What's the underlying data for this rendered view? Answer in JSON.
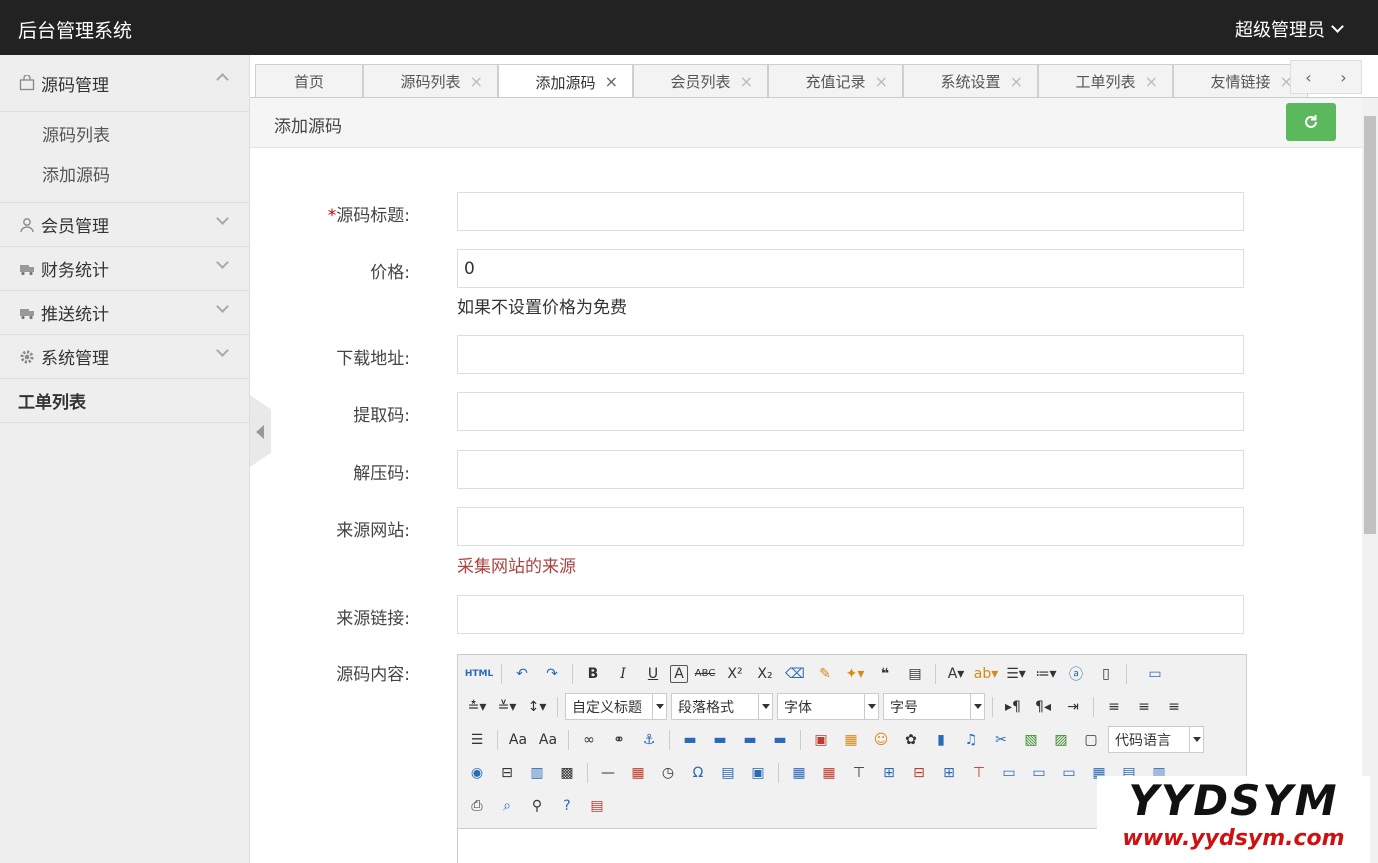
{
  "app": {
    "title": "后台管理系统",
    "user": "超级管理员"
  },
  "sidebar": {
    "groups": [
      {
        "label": "源码管理",
        "icon": "bag-icon",
        "expanded": true,
        "items": [
          "源码列表",
          "添加源码"
        ]
      },
      {
        "label": "会员管理",
        "icon": "user-icon"
      },
      {
        "label": "财务统计",
        "icon": "truck-icon"
      },
      {
        "label": "推送统计",
        "icon": "truck-icon"
      },
      {
        "label": "系统管理",
        "icon": "gear-icon"
      },
      {
        "label": "工单列表"
      }
    ]
  },
  "tabs": [
    {
      "label": "首页",
      "closable": false,
      "active": false
    },
    {
      "label": "源码列表",
      "closable": true,
      "active": false
    },
    {
      "label": "添加源码",
      "closable": true,
      "active": true
    },
    {
      "label": "会员列表",
      "closable": true,
      "active": false
    },
    {
      "label": "充值记录",
      "closable": true,
      "active": false
    },
    {
      "label": "系统设置",
      "closable": true,
      "active": false
    },
    {
      "label": "工单列表",
      "closable": true,
      "active": false
    },
    {
      "label": "友情链接",
      "closable": true,
      "active": false
    }
  ],
  "tab_close_glyph": "×",
  "page": {
    "title": "添加源码",
    "refresh_icon": "refresh-icon",
    "refresh_color": "#5cb85c"
  },
  "form": {
    "title": {
      "label": "源码标题:",
      "required_mark": "*",
      "value": ""
    },
    "price": {
      "label": "价格:",
      "value": "0",
      "help": "如果不设置价格为免费"
    },
    "download": {
      "label": "下载地址:",
      "value": ""
    },
    "extract": {
      "label": "提取码:",
      "value": ""
    },
    "unzip": {
      "label": "解压码:",
      "value": ""
    },
    "source_site": {
      "label": "来源网站:",
      "value": "",
      "help": "采集网站的来源",
      "help_color": "#a94442"
    },
    "source_link": {
      "label": "来源链接:",
      "value": ""
    },
    "content": {
      "label": "源码内容:"
    }
  },
  "editor": {
    "html_label": "HTML",
    "selects": {
      "custom_heading": "自定义标题",
      "paragraph": "段落格式",
      "font": "字体",
      "size": "字号",
      "code_lang": "代码语言"
    }
  },
  "watermark": {
    "line1": "YYDSYM",
    "line2": "www.yydsym.com"
  }
}
